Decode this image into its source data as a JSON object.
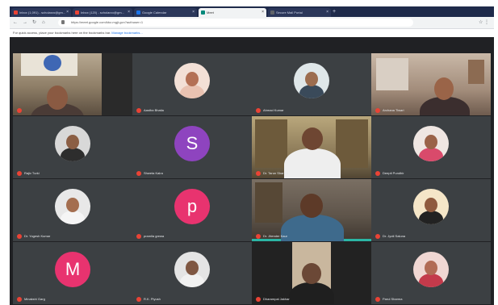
{
  "browser": {
    "tabs": [
      {
        "label": "Inbox (1,091) - scholarzo@gm...",
        "favicon_color": "#ea4335",
        "active": false
      },
      {
        "label": "Inbox (120) - scholarzo@gm...",
        "favicon_color": "#ea4335",
        "active": false
      },
      {
        "label": "Google Calendar",
        "favicon_color": "#1a73e8",
        "active": false
      },
      {
        "label": "Meet",
        "favicon_color": "#00897b",
        "active": true
      },
      {
        "label": "Secure Mail Portal",
        "favicon_color": "#5f6368",
        "active": false
      }
    ],
    "new_tab_label": "+",
    "url": "https://meet.google.com/kbz-mgjt-gcn?authuser=1",
    "back_icon": "←",
    "forward_icon": "→",
    "reload_icon": "↻",
    "home_icon": "⌂",
    "menu_icon": "⋮",
    "star_icon": "☆"
  },
  "notice": {
    "text": "For quick access, place your bookmarks here on the bookmarks bar.",
    "link": "Manage bookmarks..."
  },
  "participants": [
    {
      "name": "",
      "kind": "video",
      "theme": "office"
    },
    {
      "name": "Aastha Bhatia",
      "kind": "photo",
      "bg": "#f3e0d6",
      "head": "#b47055",
      "body": "#e9c2b1"
    },
    {
      "name": "Ahmad Kumar",
      "kind": "photo",
      "bg": "#dfe7e9",
      "head": "#9c6d4f",
      "body": "#3a4a5a"
    },
    {
      "name": "Archana Tiwari",
      "kind": "video",
      "theme": "home"
    },
    {
      "name": "Rajiv Turki",
      "kind": "photo",
      "bg": "#d8d8d8",
      "head": "#8b5e44",
      "body": "#2d2d2d"
    },
    {
      "name": "Shweta Kalra",
      "kind": "letter",
      "letter": "S",
      "color": "#8e44bf"
    },
    {
      "name": "Dr. Tarun Sharma",
      "kind": "video",
      "theme": "bookshelf"
    },
    {
      "name": "Deepti Pundhir",
      "kind": "photo",
      "bg": "#efe6e2",
      "head": "#9a6248",
      "body": "#d94a6b"
    },
    {
      "name": "Dr. Yogesh Kumar",
      "kind": "photo",
      "bg": "#e8e8e8",
      "head": "#a46e4f",
      "body": "#f5f5f5"
    },
    {
      "name": "pramila grewa",
      "kind": "letter",
      "letter": "p",
      "color": "#e8336f"
    },
    {
      "name": "Dr. Jitender Kaur",
      "kind": "video",
      "theme": "study"
    },
    {
      "name": "Dr. Jyoti Saluna",
      "kind": "photo",
      "bg": "#f5e6c8",
      "head": "#8f5a3e",
      "body": "#222"
    },
    {
      "name": "Minakshi Garg",
      "kind": "letter",
      "letter": "M",
      "color": "#e8336f"
    },
    {
      "name": "R.K. Piyush",
      "kind": "photo",
      "bg": "#e4e4e4",
      "head": "#7f5742",
      "body": "#f1f1f1"
    },
    {
      "name": "Dharampal Jakhar",
      "kind": "video",
      "theme": "doorway"
    },
    {
      "name": "Parul Sharma",
      "kind": "photo",
      "bg": "#f0d7d3",
      "head": "#b16b55",
      "body": "#c43a4b"
    }
  ]
}
